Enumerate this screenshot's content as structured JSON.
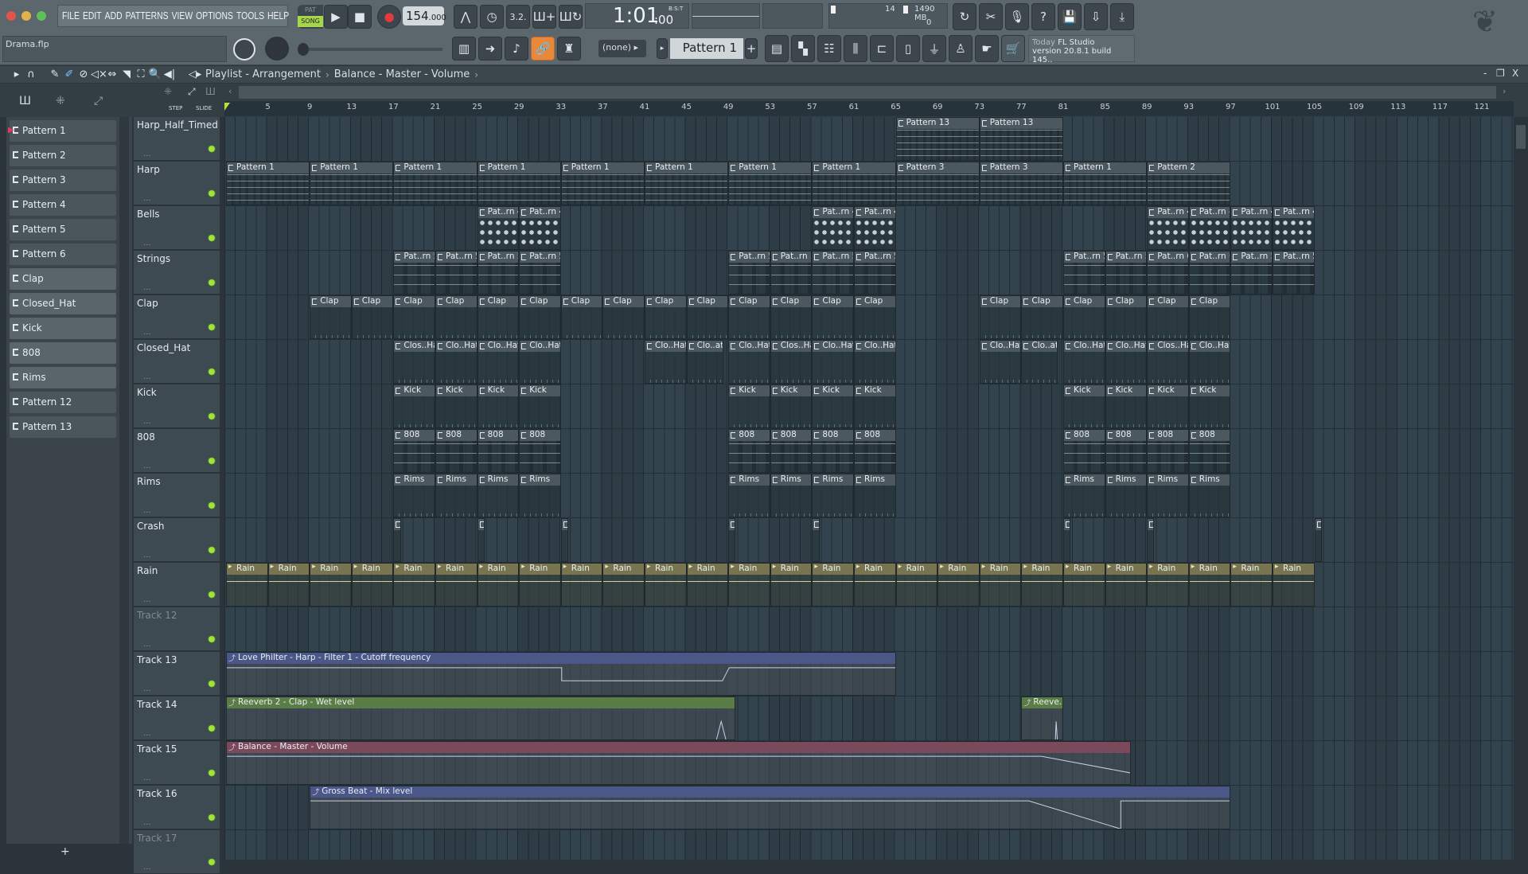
{
  "menu": [
    "FILE",
    "EDIT",
    "ADD",
    "PATTERNS",
    "VIEW",
    "OPTIONS",
    "TOOLS",
    "HELP"
  ],
  "transport": {
    "pat": "PAT",
    "song": "SONG",
    "tempo": "154",
    "tempo_dec": ".000",
    "time": "1:01",
    "time_ticks": ":00",
    "time_mode": "B:S:T"
  },
  "stats": {
    "cpu": "14",
    "memory": "1490 MB",
    "polyphony": "0"
  },
  "file": {
    "name": "Drama.flp"
  },
  "snap": {
    "value": "(none)"
  },
  "pattern_selector": {
    "value": "Pattern 1",
    "add": "+"
  },
  "hint": {
    "today": "Today",
    "title": "FL Studio",
    "version": "version 20.8.1 build 145.."
  },
  "playlist": {
    "title": "Playlist - Arrangement",
    "sep": "›",
    "current": "Balance - Master - Volume",
    "step": "STEP",
    "slide": "SLIDE"
  },
  "window_controls": {
    "minimize": "-",
    "restore": "❐",
    "close": "X"
  },
  "colors": {
    "accent": "#e8883a",
    "led": "#9fe33a",
    "auto_blue": "#4b5788",
    "auto_green": "#5a7d48",
    "auto_pink": "#7a4a5c"
  },
  "patterns": [
    "Pattern 1",
    "Pattern 2",
    "Pattern 3",
    "Pattern 4",
    "Pattern 5",
    "Pattern 6",
    "Clap",
    "Closed_Hat",
    "Kick",
    "808",
    "Rims",
    "Pattern 12",
    "Pattern 13"
  ],
  "pattern_add": "+",
  "ruler": [
    "5",
    "9",
    "13",
    "17",
    "21",
    "25",
    "29",
    "33",
    "37",
    "41",
    "45",
    "49",
    "53",
    "57",
    "61",
    "65",
    "69",
    "73",
    "77",
    "81",
    "85",
    "89",
    "93",
    "97",
    "101",
    "105",
    "109",
    "113",
    "117",
    "121"
  ],
  "tracks": [
    {
      "name": "Harp_Half_Timed",
      "type": "notes",
      "clips": [
        {
          "label": "Pattern 13",
          "start": 65,
          "len": 8
        },
        {
          "label": "Pattern 13",
          "start": 73,
          "len": 8
        }
      ]
    },
    {
      "name": "Harp",
      "type": "notes",
      "clips": [
        {
          "label": "Pattern 1",
          "start": 1,
          "len": 8
        },
        {
          "label": "Pattern 1",
          "start": 9,
          "len": 8
        },
        {
          "label": "Pattern 1",
          "start": 17,
          "len": 8
        },
        {
          "label": "Pattern 1",
          "start": 25,
          "len": 8
        },
        {
          "label": "Pattern 1",
          "start": 33,
          "len": 8
        },
        {
          "label": "Pattern 1",
          "start": 41,
          "len": 8
        },
        {
          "label": "Pattern 1",
          "start": 49,
          "len": 8
        },
        {
          "label": "Pattern 1",
          "start": 57,
          "len": 8
        },
        {
          "label": "Pattern 3",
          "start": 65,
          "len": 8
        },
        {
          "label": "Pattern 3",
          "start": 73,
          "len": 8
        },
        {
          "label": "Pattern 1",
          "start": 81,
          "len": 8
        },
        {
          "label": "Pattern 2",
          "start": 89,
          "len": 8
        }
      ]
    },
    {
      "name": "Bells",
      "type": "steps",
      "clips": [
        {
          "label": "Pat..rn 4",
          "start": 25,
          "len": 4
        },
        {
          "label": "Pat..rn 4",
          "start": 29,
          "len": 4
        },
        {
          "label": "Pat..rn 4",
          "start": 57,
          "len": 4
        },
        {
          "label": "Pat..rn 4",
          "start": 61,
          "len": 4
        },
        {
          "label": "Pat..rn 4",
          "start": 89,
          "len": 4
        },
        {
          "label": "Pat..rn 4",
          "start": 93,
          "len": 4
        },
        {
          "label": "Pat..rn 4",
          "start": 97,
          "len": 4
        },
        {
          "label": "Pat..rn 4",
          "start": 101,
          "len": 4
        }
      ]
    },
    {
      "name": "Strings",
      "type": "lines",
      "clips": [
        {
          "label": "Pat..rn 5",
          "start": 17,
          "len": 4
        },
        {
          "label": "Pat..rn 5",
          "start": 21,
          "len": 4
        },
        {
          "label": "Pat..rn 5",
          "start": 25,
          "len": 4
        },
        {
          "label": "Pat..rn 5",
          "start": 29,
          "len": 4
        },
        {
          "label": "Pat..rn 5",
          "start": 49,
          "len": 4
        },
        {
          "label": "Pat..rn 5",
          "start": 53,
          "len": 4
        },
        {
          "label": "Pat..rn 5",
          "start": 57,
          "len": 4
        },
        {
          "label": "Pat..rn 5",
          "start": 61,
          "len": 4
        },
        {
          "label": "Pat..rn 5",
          "start": 81,
          "len": 4
        },
        {
          "label": "Pat..rn 5",
          "start": 85,
          "len": 4
        },
        {
          "label": "Pat..rn 6",
          "start": 89,
          "len": 4
        },
        {
          "label": "Pat..rn 6",
          "start": 93,
          "len": 4
        },
        {
          "label": "Pat..rn 5",
          "start": 97,
          "len": 4
        },
        {
          "label": "Pat..rn 5",
          "start": 101,
          "len": 4
        }
      ]
    },
    {
      "name": "Clap",
      "type": "ticks",
      "clips": [
        {
          "label": "Clap",
          "start": 9,
          "len": 4
        },
        {
          "label": "Clap",
          "start": 13,
          "len": 4
        },
        {
          "label": "Clap",
          "start": 17,
          "len": 4
        },
        {
          "label": "Clap",
          "start": 21,
          "len": 4
        },
        {
          "label": "Clap",
          "start": 25,
          "len": 4
        },
        {
          "label": "Clap",
          "start": 29,
          "len": 4
        },
        {
          "label": "Clap",
          "start": 33,
          "len": 4
        },
        {
          "label": "Clap",
          "start": 37,
          "len": 4
        },
        {
          "label": "Clap",
          "start": 41,
          "len": 4
        },
        {
          "label": "Clap",
          "start": 45,
          "len": 4
        },
        {
          "label": "Clap",
          "start": 49,
          "len": 4
        },
        {
          "label": "Clap",
          "start": 53,
          "len": 4
        },
        {
          "label": "Clap",
          "start": 57,
          "len": 4
        },
        {
          "label": "Clap",
          "start": 61,
          "len": 4
        },
        {
          "label": "Clap",
          "start": 73,
          "len": 4
        },
        {
          "label": "Clap",
          "start": 77,
          "len": 4
        },
        {
          "label": "Clap",
          "start": 81,
          "len": 4
        },
        {
          "label": "Clap",
          "start": 85,
          "len": 4
        },
        {
          "label": "Clap",
          "start": 89,
          "len": 4
        },
        {
          "label": "Clap",
          "start": 93,
          "len": 4
        }
      ]
    },
    {
      "name": "Closed_Hat",
      "type": "ticks",
      "clips": [
        {
          "label": "Clos..Hat",
          "start": 17,
          "len": 4
        },
        {
          "label": "Clo..Hat",
          "start": 21,
          "len": 4
        },
        {
          "label": "Clo..Hat",
          "start": 25,
          "len": 4
        },
        {
          "label": "Clo..Hat",
          "start": 29,
          "len": 4
        },
        {
          "label": "Clo..Hat",
          "start": 41,
          "len": 4
        },
        {
          "label": "Clo..at",
          "start": 45,
          "len": 3.5
        },
        {
          "label": "Clo..Hat",
          "start": 49,
          "len": 4
        },
        {
          "label": "Clos..Hat",
          "start": 53,
          "len": 4
        },
        {
          "label": "Clo..Hat",
          "start": 57,
          "len": 4
        },
        {
          "label": "Clo..Hat",
          "start": 61,
          "len": 4
        },
        {
          "label": "Clo..Hat",
          "start": 73,
          "len": 4
        },
        {
          "label": "Clo..at",
          "start": 77,
          "len": 3.5
        },
        {
          "label": "Clo..Hat",
          "start": 81,
          "len": 4
        },
        {
          "label": "Clo..Hat",
          "start": 85,
          "len": 4
        },
        {
          "label": "Clos..Hat",
          "start": 89,
          "len": 4
        },
        {
          "label": "Clo..Hat",
          "start": 93,
          "len": 4
        }
      ]
    },
    {
      "name": "Kick",
      "type": "ticks",
      "clips": [
        {
          "label": "Kick",
          "start": 17,
          "len": 4
        },
        {
          "label": "Kick",
          "start": 21,
          "len": 4
        },
        {
          "label": "Kick",
          "start": 25,
          "len": 4
        },
        {
          "label": "Kick",
          "start": 29,
          "len": 4
        },
        {
          "label": "Kick",
          "start": 49,
          "len": 4
        },
        {
          "label": "Kick",
          "start": 53,
          "len": 4
        },
        {
          "label": "Kick",
          "start": 57,
          "len": 4
        },
        {
          "label": "Kick",
          "start": 61,
          "len": 4
        },
        {
          "label": "Kick",
          "start": 81,
          "len": 4
        },
        {
          "label": "Kick",
          "start": 85,
          "len": 4
        },
        {
          "label": "Kick",
          "start": 89,
          "len": 4
        },
        {
          "label": "Kick",
          "start": 93,
          "len": 4
        }
      ]
    },
    {
      "name": "808",
      "type": "lines",
      "clips": [
        {
          "label": "808",
          "start": 17,
          "len": 4
        },
        {
          "label": "808",
          "start": 21,
          "len": 4
        },
        {
          "label": "808",
          "start": 25,
          "len": 4
        },
        {
          "label": "808",
          "start": 29,
          "len": 4
        },
        {
          "label": "808",
          "start": 49,
          "len": 4
        },
        {
          "label": "808",
          "start": 53,
          "len": 4
        },
        {
          "label": "808",
          "start": 57,
          "len": 4
        },
        {
          "label": "808",
          "start": 61,
          "len": 4
        },
        {
          "label": "808",
          "start": 81,
          "len": 4
        },
        {
          "label": "808",
          "start": 85,
          "len": 4
        },
        {
          "label": "808",
          "start": 89,
          "len": 4
        },
        {
          "label": "808",
          "start": 93,
          "len": 4
        }
      ]
    },
    {
      "name": "Rims",
      "type": "ticks",
      "clips": [
        {
          "label": "Rims",
          "start": 17,
          "len": 4
        },
        {
          "label": "Rims",
          "start": 21,
          "len": 4
        },
        {
          "label": "Rims",
          "start": 25,
          "len": 4
        },
        {
          "label": "Rims",
          "start": 29,
          "len": 4
        },
        {
          "label": "Rims",
          "start": 49,
          "len": 4
        },
        {
          "label": "Rims",
          "start": 53,
          "len": 4
        },
        {
          "label": "Rims",
          "start": 57,
          "len": 4
        },
        {
          "label": "Rims",
          "start": 61,
          "len": 4
        },
        {
          "label": "Rims",
          "start": 81,
          "len": 4
        },
        {
          "label": "Rims",
          "start": 85,
          "len": 4
        },
        {
          "label": "Rims",
          "start": 89,
          "len": 4
        },
        {
          "label": "Rims",
          "start": 93,
          "len": 4
        }
      ]
    },
    {
      "name": "Crash",
      "type": "crash",
      "clips": [
        {
          "label": "",
          "start": 17,
          "len": 0.7
        },
        {
          "label": "",
          "start": 25,
          "len": 0.7
        },
        {
          "label": "",
          "start": 33,
          "len": 0.7
        },
        {
          "label": "",
          "start": 49,
          "len": 0.7
        },
        {
          "label": "",
          "start": 57,
          "len": 0.7
        },
        {
          "label": "",
          "start": 81,
          "len": 0.7
        },
        {
          "label": "",
          "start": 89,
          "len": 0.7
        },
        {
          "label": "",
          "start": 105,
          "len": 0.7
        }
      ]
    },
    {
      "name": "Rain",
      "type": "rain",
      "clips": [
        {
          "label": "Rain",
          "start": 1,
          "len": 4
        },
        {
          "label": "Rain",
          "start": 5,
          "len": 4
        },
        {
          "label": "Rain",
          "start": 9,
          "len": 4
        },
        {
          "label": "Rain",
          "start": 13,
          "len": 4
        },
        {
          "label": "Rain",
          "start": 17,
          "len": 4
        },
        {
          "label": "Rain",
          "start": 21,
          "len": 4
        },
        {
          "label": "Rain",
          "start": 25,
          "len": 4
        },
        {
          "label": "Rain",
          "start": 29,
          "len": 4
        },
        {
          "label": "Rain",
          "start": 33,
          "len": 4
        },
        {
          "label": "Rain",
          "start": 37,
          "len": 4
        },
        {
          "label": "Rain",
          "start": 41,
          "len": 4
        },
        {
          "label": "Rain",
          "start": 45,
          "len": 4
        },
        {
          "label": "Rain",
          "start": 49,
          "len": 4
        },
        {
          "label": "Rain",
          "start": 53,
          "len": 4
        },
        {
          "label": "Rain",
          "start": 57,
          "len": 4
        },
        {
          "label": "Rain",
          "start": 61,
          "len": 4
        },
        {
          "label": "Rain",
          "start": 65,
          "len": 4
        },
        {
          "label": "Rain",
          "start": 69,
          "len": 4
        },
        {
          "label": "Rain",
          "start": 73,
          "len": 4
        },
        {
          "label": "Rain",
          "start": 77,
          "len": 4
        },
        {
          "label": "Rain",
          "start": 81,
          "len": 4
        },
        {
          "label": "Rain",
          "start": 85,
          "len": 4
        },
        {
          "label": "Rain",
          "start": 89,
          "len": 4
        },
        {
          "label": "Rain",
          "start": 93,
          "len": 4
        },
        {
          "label": "Rain",
          "start": 97,
          "len": 4
        },
        {
          "label": "Rain",
          "start": 101,
          "len": 4
        }
      ]
    },
    {
      "name": "Track 12",
      "type": "empty",
      "dim": true,
      "clips": []
    },
    {
      "name": "Track 13",
      "type": "auto",
      "clips": [
        {
          "label": "Love Philter - Harp - Filter 1 - Cutoff frequency",
          "start": 1,
          "len": 64,
          "color": "#4b5788",
          "env": [
            [
              0,
              0.12
            ],
            [
              0.5,
              0.12
            ],
            [
              0.5,
              0.52
            ],
            [
              0.74,
              0.52
            ],
            [
              0.75,
              0.12
            ],
            [
              1,
              0.12
            ]
          ]
        }
      ]
    },
    {
      "name": "Track 14",
      "type": "auto",
      "clips": [
        {
          "label": "Reeverb 2 - Clap - Wet level",
          "start": 1,
          "len": 48.7,
          "color": "#5a7d48",
          "env": [
            [
              0,
              1
            ],
            [
              0.96,
              1
            ],
            [
              0.97,
              0.4
            ],
            [
              0.98,
              1
            ],
            [
              1,
              1
            ]
          ]
        },
        {
          "label": "Reeve...evel",
          "start": 77,
          "len": 4,
          "color": "#5a7d48",
          "env": [
            [
              0,
              1
            ],
            [
              0.8,
              1
            ],
            [
              0.82,
              0.4
            ],
            [
              0.85,
              1
            ],
            [
              1,
              1
            ]
          ]
        }
      ]
    },
    {
      "name": "Track 15",
      "type": "auto",
      "clips": [
        {
          "label": "Balance - Master - Volume",
          "start": 1,
          "len": 86.5,
          "color": "#7a4a5c",
          "env": [
            [
              0,
              0.1
            ],
            [
              0.9,
              0.1
            ],
            [
              1,
              0.62
            ]
          ]
        }
      ]
    },
    {
      "name": "Track 16",
      "type": "auto",
      "clips": [
        {
          "label": "Gross Beat - Mix level",
          "start": 9,
          "len": 88,
          "color": "#4b5788",
          "env": [
            [
              0,
              0.1
            ],
            [
              0.78,
              0.1
            ],
            [
              0.88,
              0.96
            ],
            [
              0.88,
              0.1
            ],
            [
              1,
              0.1
            ]
          ]
        }
      ]
    },
    {
      "name": "Track 17",
      "type": "empty",
      "dim": true,
      "clips": []
    }
  ]
}
